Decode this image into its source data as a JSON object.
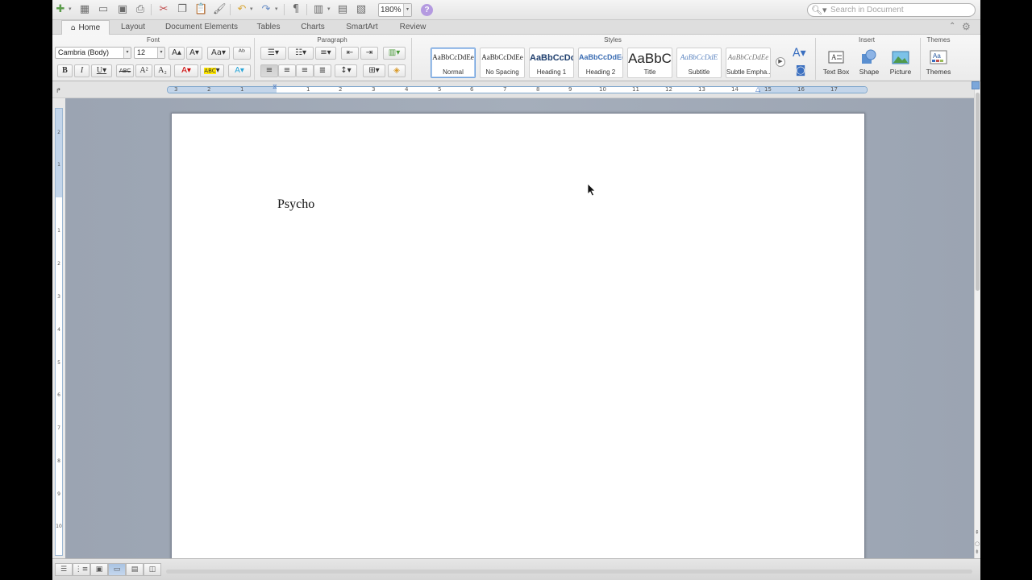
{
  "toolbar": {
    "zoom": "180%",
    "search_placeholder": "Search in Document"
  },
  "tabs": [
    "Home",
    "Layout",
    "Document Elements",
    "Tables",
    "Charts",
    "SmartArt",
    "Review"
  ],
  "ribbon": {
    "groups": {
      "font": "Font",
      "paragraph": "Paragraph",
      "styles": "Styles",
      "insert": "Insert",
      "themes": "Themes"
    },
    "font_name": "Cambria (Body)",
    "font_size": "12",
    "format_buttons": {
      "bold": "B",
      "italic": "I",
      "underline": "U",
      "strike": "ABC",
      "superscript": "A²",
      "subscript": "A₂"
    },
    "styles": [
      {
        "sample": "AaBbCcDdEe",
        "name": "Normal"
      },
      {
        "sample": "AaBbCcDdEe",
        "name": "No Spacing"
      },
      {
        "sample": "AaBbCcDc",
        "name": "Heading 1"
      },
      {
        "sample": "AaBbCcDdEe",
        "name": "Heading 2"
      },
      {
        "sample": "AaBbC",
        "name": "Title"
      },
      {
        "sample": "AaBbCcDdE",
        "name": "Subtitle"
      },
      {
        "sample": "AaBbCcDdEe",
        "name": "Subtle Empha..."
      }
    ],
    "insert": {
      "text_box": "Text Box",
      "shape": "Shape",
      "picture": "Picture"
    },
    "themes_label": "Themes"
  },
  "ruler": {
    "numbers": [
      "3",
      "2",
      "1",
      "1",
      "2",
      "3",
      "4",
      "5",
      "6",
      "7",
      "8",
      "9",
      "10",
      "11",
      "12",
      "13",
      "14",
      "15",
      "16",
      "17"
    ]
  },
  "vruler": {
    "numbers": [
      "2",
      "1",
      "1",
      "2",
      "3",
      "4",
      "5",
      "6",
      "7",
      "8",
      "9",
      "10"
    ]
  },
  "document": {
    "text": "Psycho"
  },
  "colors": {
    "accent": "#6ea0dc",
    "canvas": "#a1aab7",
    "font_color_bar": "#e02020",
    "highlight_bar": "#ffe600"
  }
}
